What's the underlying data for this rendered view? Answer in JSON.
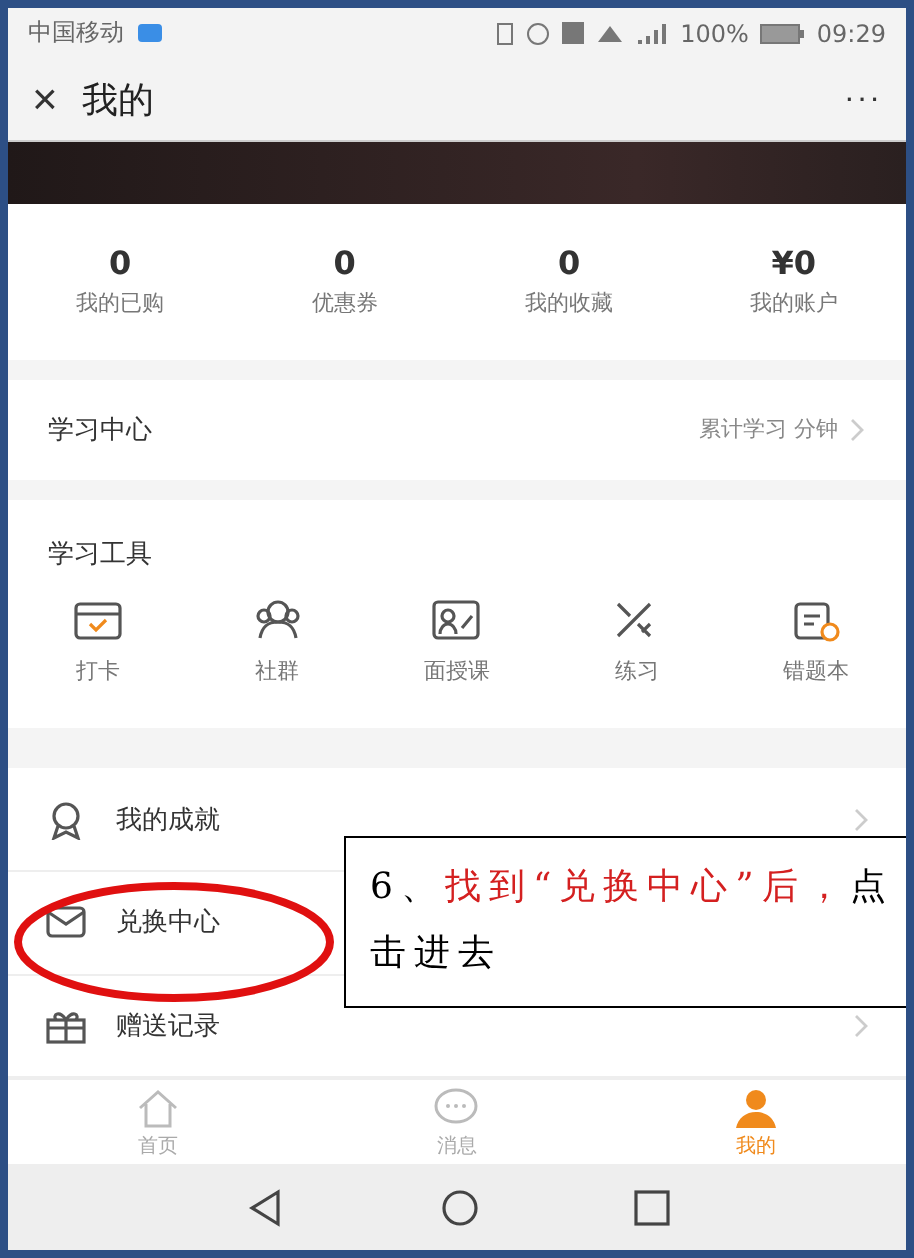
{
  "status_bar": {
    "carrier": "中国移动",
    "battery": "100%",
    "time": "09:29"
  },
  "nav": {
    "close": "×",
    "title": "我的",
    "more": "···"
  },
  "stats": [
    {
      "value": "0",
      "label": "我的已购"
    },
    {
      "value": "0",
      "label": "优惠券"
    },
    {
      "value": "0",
      "label": "我的收藏"
    },
    {
      "value": "¥0",
      "label": "我的账户"
    }
  ],
  "study_center": {
    "title": "学习中心",
    "summary": "累计学习 分钟"
  },
  "tools": {
    "title": "学习工具",
    "items": [
      {
        "kind": "checkin",
        "label": "打卡"
      },
      {
        "kind": "group",
        "label": "社群"
      },
      {
        "kind": "class",
        "label": "面授课"
      },
      {
        "kind": "practice",
        "label": "练习"
      },
      {
        "kind": "mistakes",
        "label": "错题本"
      }
    ]
  },
  "menu": [
    {
      "kind": "medal",
      "label": "我的成就",
      "chevron": true
    },
    {
      "kind": "envelope",
      "label": "兑换中心",
      "chevron": false
    },
    {
      "kind": "gift",
      "label": "赠送记录",
      "chevron": true
    }
  ],
  "tab_bar": [
    {
      "kind": "home",
      "label": "首页",
      "selected": false
    },
    {
      "kind": "chat",
      "label": "消息",
      "selected": false
    },
    {
      "kind": "person",
      "label": "我的",
      "selected": true
    }
  ],
  "callout": {
    "segments": [
      {
        "kind": "plain",
        "text": "6、"
      },
      {
        "kind": "highlight",
        "text": "找到“兑换中心”后，"
      },
      {
        "kind": "plain",
        "text": "点击进去"
      }
    ]
  }
}
